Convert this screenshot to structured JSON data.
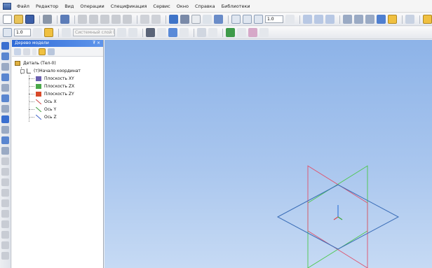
{
  "menu": {
    "items": [
      "Файл",
      "Редактор",
      "Вид",
      "Операции",
      "Спецификация",
      "Сервис",
      "Окно",
      "Справка",
      "Библиотеки"
    ]
  },
  "toolbar1": {
    "zoom_value": "1.0"
  },
  "toolbar2": {
    "step_value": "1.0",
    "style_placeholder": "Системный слой (0)"
  },
  "tree": {
    "title": "Дерево модели",
    "pin_close": "₮ ×",
    "part_label": "Деталь (Тел-0)",
    "origin_label": "(т)Начало координат",
    "nodes": [
      {
        "label": "Плоскость XY",
        "color": "#6a5fb0",
        "icon": "plane-xy-icon"
      },
      {
        "label": "Плоскость ZX",
        "color": "#4aa84a",
        "icon": "plane-zx-icon"
      },
      {
        "label": "Плоскость ZY",
        "color": "#d84a2a",
        "icon": "plane-zy-icon"
      },
      {
        "label": "Ось X",
        "color": "#cc4040",
        "icon": "axis-x-icon"
      },
      {
        "label": "Ось Y",
        "color": "#3a9a3a",
        "icon": "axis-y-icon"
      },
      {
        "label": "Ось Z",
        "color": "#3a5ec8",
        "icon": "axis-z-icon"
      }
    ]
  },
  "colors": {
    "viewport_top": "#8db3e8",
    "viewport_bottom": "#c6daf4",
    "plane_xy": "#3d6fb8",
    "plane_zx": "#4ac84a",
    "plane_zy": "#e0506a",
    "header_blue": "#2f6bd8"
  }
}
